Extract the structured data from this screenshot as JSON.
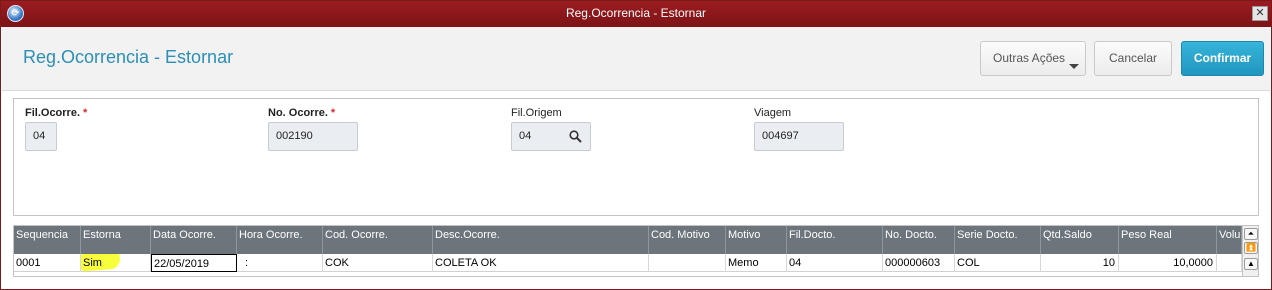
{
  "window": {
    "title": "Reg.Ocorrencia - Estornar",
    "close_glyph": "✕"
  },
  "header": {
    "title": "Reg.Ocorrencia - Estornar",
    "buttons": {
      "outras": "Outras Ações",
      "cancelar": "Cancelar",
      "confirmar": "Confirmar"
    }
  },
  "form": {
    "fil_ocorre": {
      "label": "Fil.Ocorre.",
      "required": "*",
      "value": "04"
    },
    "no_ocorre": {
      "label": "No. Ocorre.",
      "required": "*",
      "value": "002190"
    },
    "fil_origem": {
      "label": "Fil.Origem",
      "value": "04",
      "icon": "search-icon"
    },
    "viagem": {
      "label": "Viagem",
      "value": "004697"
    }
  },
  "grid": {
    "columns": [
      "Sequencia",
      "Estorna",
      "Data Ocorre.",
      "Hora Ocorre.",
      "Cod. Ocorre.",
      "Desc.Ocorre.",
      "Cod. Motivo",
      "Motivo",
      "Fil.Docto.",
      "No. Docto.",
      "Serie Docto.",
      "Qtd.Saldo",
      "Peso Real",
      "Volu"
    ],
    "rows": [
      [
        "0001",
        "Sim",
        "22/05/2019",
        ":",
        "COK",
        "COLETA OK",
        "",
        "Memo",
        "04",
        "000000603",
        "COL",
        "10",
        "10,0000",
        ""
      ]
    ],
    "highlight_color": "#f7ff3c"
  },
  "scrollbar": {
    "top_glyph": "⏶",
    "pageup_glyph": "⏫",
    "up_glyph": "▲"
  },
  "colors": {
    "titlebar": "#8a171a",
    "title_text": "#2b8fb6",
    "confirm": "#2aa5cc",
    "grid_header": "#6c757c"
  }
}
